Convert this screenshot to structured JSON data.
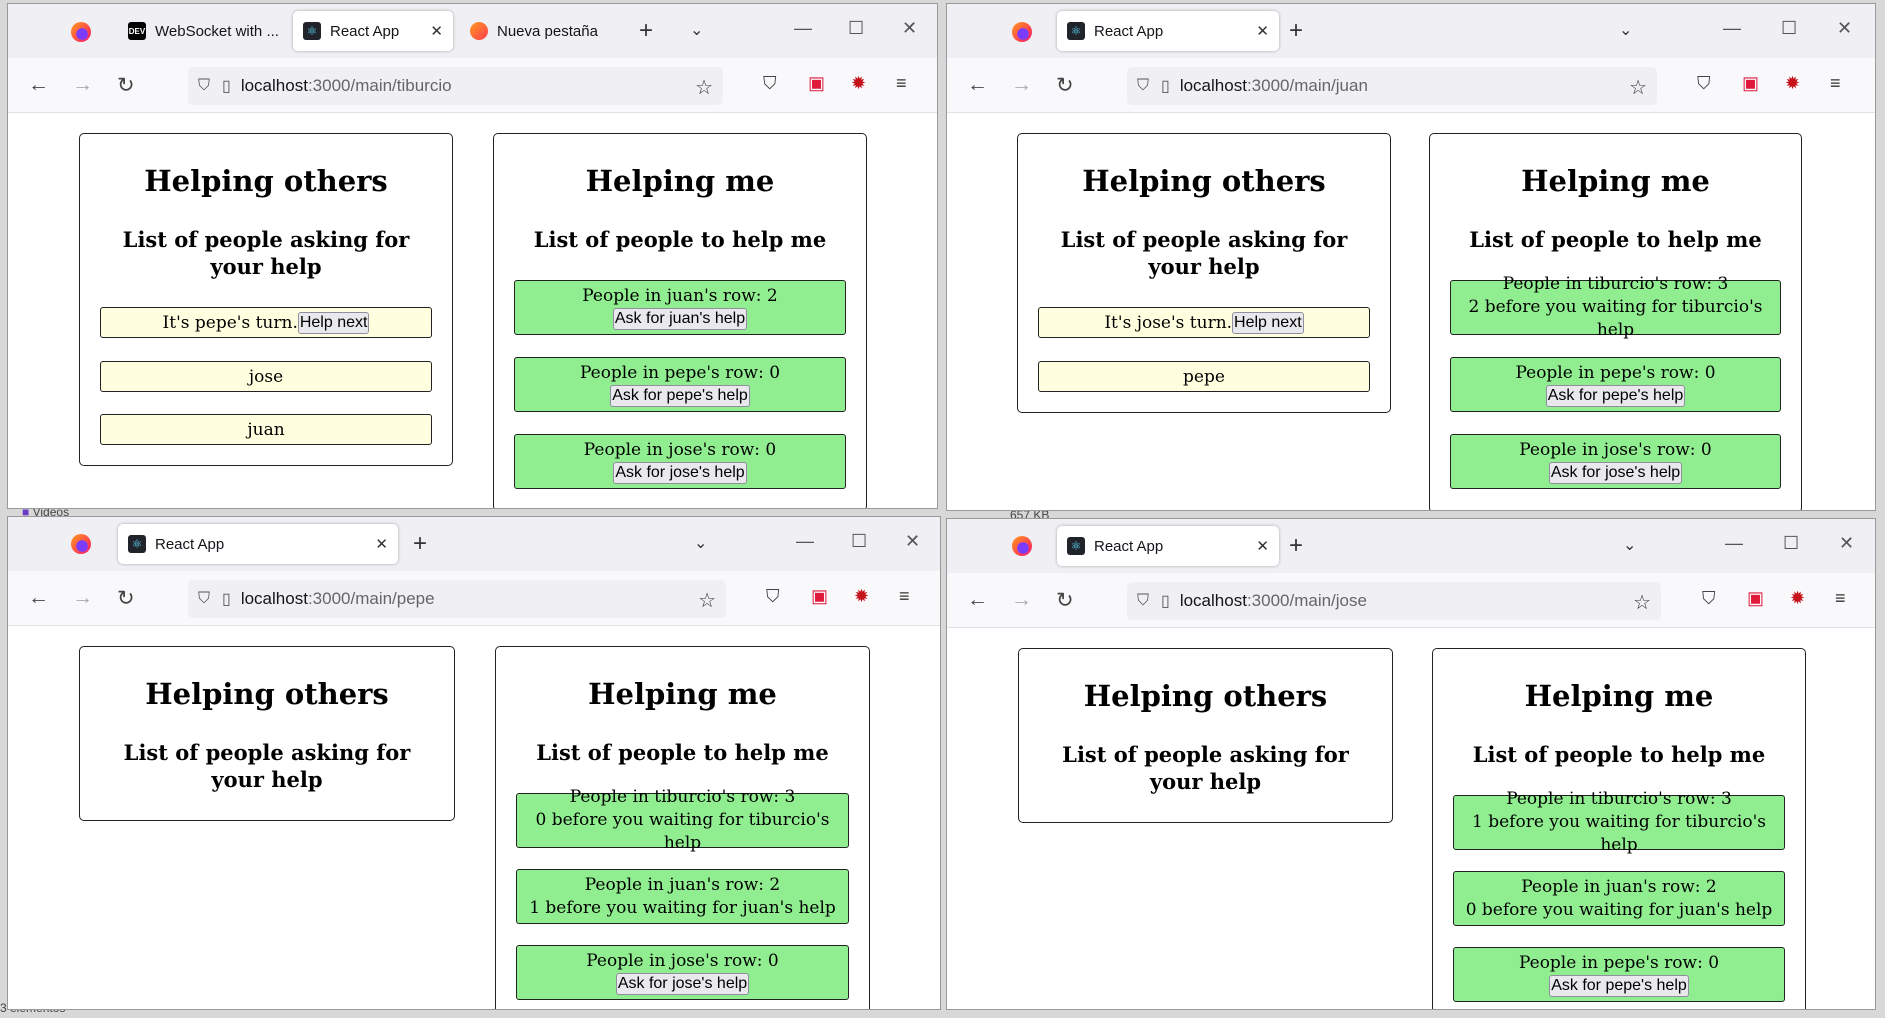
{
  "background": {
    "videos_label": "Videos",
    "footer_label": "3 elementos",
    "size_label": "657 KB"
  },
  "windows": {
    "tl": {
      "tabs": [
        "WebSocket with ...",
        "React App",
        "Nueva pestaña"
      ],
      "url_host": "localhost",
      "url_path": ":3000/main/tiburcio",
      "others": {
        "title": "Helping others",
        "subtitle": "List of people asking for your help",
        "turn_text": "It's pepe's turn.",
        "help_next": "Help next",
        "queue": [
          "jose",
          "juan"
        ]
      },
      "me": {
        "title": "Helping me",
        "subtitle": "List of people to help me",
        "rows": [
          {
            "text": "People in juan's row: 2",
            "button": "Ask for juan's help"
          },
          {
            "text": "People in pepe's row: 0",
            "button": "Ask for pepe's help"
          },
          {
            "text": "People in jose's row: 0",
            "button": "Ask for jose's help"
          }
        ]
      }
    },
    "tr": {
      "tabs": [
        "React App"
      ],
      "url_host": "localhost",
      "url_path": ":3000/main/juan",
      "others": {
        "title": "Helping others",
        "subtitle": "List of people asking for your help",
        "turn_text": "It's jose's turn.",
        "help_next": "Help next",
        "queue": [
          "pepe"
        ]
      },
      "me": {
        "title": "Helping me",
        "subtitle": "List of people to help me",
        "rows": [
          {
            "text": "People in tiburcio's row: 3",
            "sub": "2 before you waiting for tiburcio's help"
          },
          {
            "text": "People in pepe's row: 0",
            "button": "Ask for pepe's help"
          },
          {
            "text": "People in jose's row: 0",
            "button": "Ask for jose's help"
          }
        ]
      }
    },
    "bl": {
      "tabs": [
        "React App"
      ],
      "url_host": "localhost",
      "url_path": ":3000/main/pepe",
      "others": {
        "title": "Helping others",
        "subtitle": "List of people asking for your help"
      },
      "me": {
        "title": "Helping me",
        "subtitle": "List of people to help me",
        "rows": [
          {
            "text": "People in tiburcio's row: 3",
            "sub": "0 before you waiting for tiburcio's help"
          },
          {
            "text": "People in juan's row: 2",
            "sub": "1 before you waiting for juan's help"
          },
          {
            "text": "People in jose's row: 0",
            "button": "Ask for jose's help"
          }
        ]
      }
    },
    "br": {
      "tabs": [
        "React App"
      ],
      "url_host": "localhost",
      "url_path": ":3000/main/jose",
      "others": {
        "title": "Helping others",
        "subtitle": "List of people asking for your help"
      },
      "me": {
        "title": "Helping me",
        "subtitle": "List of people to help me",
        "rows": [
          {
            "text": "People in tiburcio's row: 3",
            "sub": "1 before you waiting for tiburcio's help"
          },
          {
            "text": "People in juan's row: 2",
            "sub": "0 before you waiting for juan's help"
          },
          {
            "text": "People in pepe's row: 0",
            "button": "Ask for pepe's help"
          }
        ]
      }
    }
  },
  "icons": {
    "back": "back-arrow-icon",
    "forward": "forward-arrow-icon",
    "reload": "reload-icon",
    "shield": "tracking-shield-icon",
    "page": "page-icon",
    "bookmark": "bookmark-star-icon",
    "pocket": "pocket-icon",
    "ext_red": "extension-icon",
    "menu": "hamburger-menu-icon"
  }
}
